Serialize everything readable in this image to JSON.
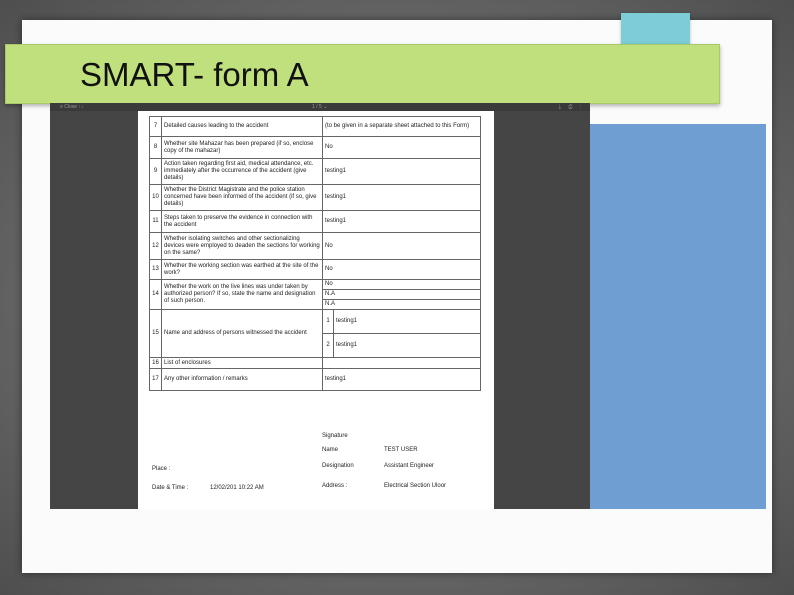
{
  "slide": {
    "title": "SMART- form A",
    "colors": {
      "title_band": "#bfe07c",
      "accent_blue_top": "#7ccdd8",
      "accent_blue_right": "#6e9ed2",
      "accent_orange": "#e8734a",
      "viewer_bg": "#454545"
    }
  },
  "viewer": {
    "toolbar_left": "≡ Close ↑↓",
    "toolbar_page": "1 / 5 ⌄",
    "toolbar_right": "⤓ ⎙ ⋮"
  },
  "form": {
    "rows": [
      {
        "num": "7",
        "question": "Detailed causes leading to the accident",
        "answer": "(to be given in a separate sheet attached to this Form)"
      },
      {
        "num": "8",
        "question": "Whether site Mahazar has been prepared (if so, enclose copy of the mahazar)",
        "answer": "No"
      },
      {
        "num": "9",
        "question": "Action taken regarding first aid, medical attendance, etc. immediately after the occurrence of the accident (give details)",
        "answer": "testing1"
      },
      {
        "num": "10",
        "question": "Whether the District Magistrate and the police station concerned have been informed of the accident (if so, give details)",
        "answer": "testing1"
      },
      {
        "num": "11",
        "question": "Steps taken to preserve the evidence in connection with the accident",
        "answer": "testing1"
      },
      {
        "num": "12",
        "question": "Whether isolating switches and other sectionalizing devices were employed to deaden the sections for working on the same?",
        "answer": "No"
      },
      {
        "num": "13",
        "question": "Whether the working section was earthed at the site of the work?",
        "answer": "No"
      }
    ],
    "row14": {
      "num": "14",
      "question": "Whether the work on the live lines was under taken by authorized person? If so, state the name and designation of such person.",
      "answers": [
        "No",
        "N.A",
        "N.A"
      ]
    },
    "row15": {
      "num": "15",
      "question": "Name and address of persons witnessed the accident",
      "witnesses": [
        {
          "num": "1",
          "value": "testing1"
        },
        {
          "num": "2",
          "value": "testing1"
        }
      ]
    },
    "row16": {
      "num": "16",
      "question": "List of enclosures",
      "answer": ""
    },
    "row17": {
      "num": "17",
      "question": "Any other information / remarks",
      "answer": "testing1"
    }
  },
  "signature": {
    "heading": "Signature",
    "name_label": "Name",
    "name_value": "TEST USER",
    "designation_label": "Designation",
    "designation_value": "Assistant Engineer",
    "address_label": "Address :",
    "address_value": "Electrical Section Uloor",
    "place_label": "Place :",
    "datetime_label": "Date & Time :",
    "datetime_value": "12/02/201  10:22 AM"
  }
}
